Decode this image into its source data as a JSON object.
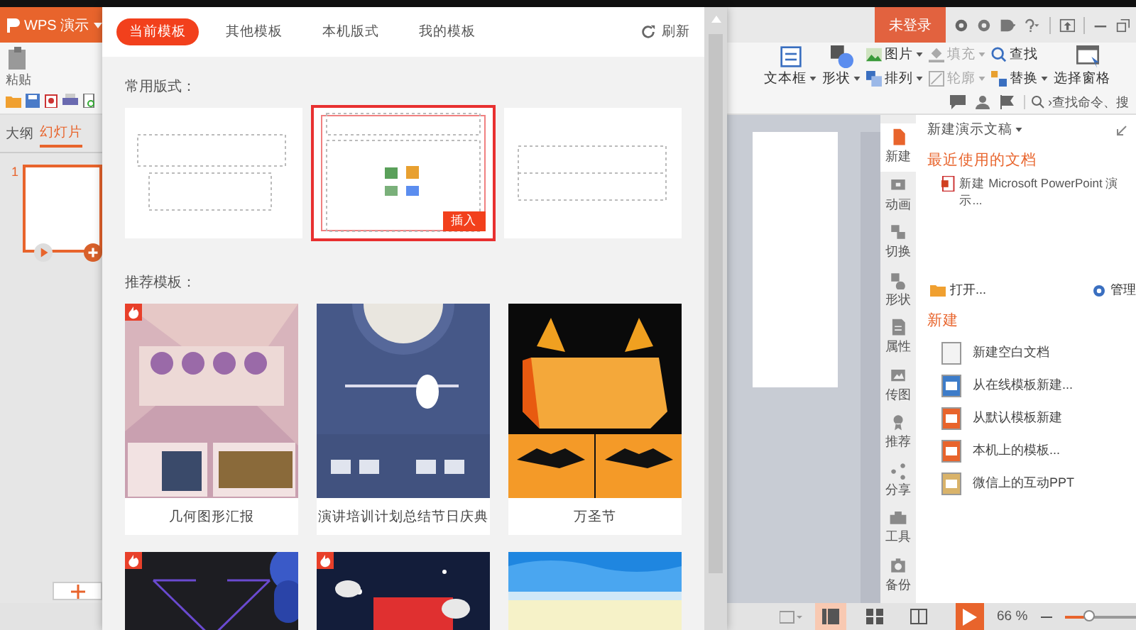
{
  "titlebar": {
    "app_name": "WPS 演示",
    "login": "未登录"
  },
  "ribbon": {
    "paste": "粘贴",
    "columns": [
      [
        {
          "label": "文本框",
          "kind": "textbox",
          "dropdown": true,
          "disabled": false
        }
      ],
      [
        {
          "label": "形状",
          "kind": "shape",
          "dropdown": true,
          "disabled": false
        }
      ],
      [
        {
          "label": "图片",
          "kind": "picture",
          "dropdown": true,
          "disabled": false
        },
        {
          "label": "排列",
          "kind": "arrange",
          "dropdown": true,
          "disabled": false
        }
      ],
      [
        {
          "label": "填充",
          "kind": "fill",
          "dropdown": true,
          "disabled": true
        },
        {
          "label": "轮廓",
          "kind": "outline",
          "dropdown": true,
          "disabled": true
        }
      ],
      [
        {
          "label": "查找",
          "kind": "find",
          "dropdown": false,
          "disabled": false
        },
        {
          "label": "替换",
          "kind": "replace",
          "dropdown": true,
          "disabled": false
        }
      ],
      [
        {
          "label": "选择窗格",
          "kind": "pane",
          "dropdown": false,
          "disabled": false
        }
      ]
    ],
    "search": {
      "placeholder": "›查找命令、搜"
    }
  },
  "slides_panel": {
    "tabs": [
      {
        "label": "大纲",
        "selected": false
      },
      {
        "label": "幻灯片",
        "selected": true
      }
    ],
    "slides": [
      {
        "number": "1",
        "selected": true
      }
    ]
  },
  "gallery": {
    "tabs": [
      {
        "label": "当前模板",
        "selected": true
      },
      {
        "label": "其他模板",
        "selected": false
      },
      {
        "label": "本机版式",
        "selected": false
      },
      {
        "label": "我的模板",
        "selected": false
      }
    ],
    "refresh": "刷新",
    "layouts_heading": "常用版式：",
    "layouts": [
      {
        "kind": "title",
        "selected": false
      },
      {
        "kind": "title_content",
        "selected": true
      },
      {
        "kind": "section",
        "selected": false
      }
    ],
    "insert": "插入",
    "templates_heading": "推荐模板：",
    "templates": [
      {
        "name": "几何图形汇报",
        "kind": "geometry",
        "premium": true
      },
      {
        "name": "演讲培训计划总结节日庆典",
        "kind": "moon",
        "premium": false
      },
      {
        "name": "万圣节",
        "kind": "halloween",
        "premium": false
      },
      {
        "kind": "dark",
        "premium": true
      },
      {
        "kind": "night",
        "premium": true
      },
      {
        "kind": "blue",
        "premium": false
      }
    ]
  },
  "side_tabs": [
    {
      "label": "新建",
      "kind": "new",
      "selected": true
    },
    {
      "label": "动画",
      "kind": "animation",
      "selected": false
    },
    {
      "label": "切换",
      "kind": "transition",
      "selected": false
    },
    {
      "label": "形状",
      "kind": "shape",
      "selected": false
    },
    {
      "label": "属性",
      "kind": "property",
      "selected": false
    },
    {
      "label": "传图",
      "kind": "upload",
      "selected": false
    },
    {
      "label": "推荐",
      "kind": "award",
      "selected": false
    },
    {
      "label": "分享",
      "kind": "share",
      "selected": false
    },
    {
      "label": "工具",
      "kind": "toolbox",
      "selected": false
    },
    {
      "label": "备份",
      "kind": "backup",
      "selected": false
    }
  ],
  "task_pane": {
    "title": "新建演示文稿",
    "recent_heading": "最近使用的文档",
    "recent": [
      {
        "name": "新建 Microsoft PowerPoint 演示..."
      }
    ],
    "open": "打开...",
    "manage": "管理",
    "new_heading": "新建",
    "new_items": [
      {
        "label": "新建空白文档",
        "kind": "blank"
      },
      {
        "label": "从在线模板新建...",
        "kind": "online"
      },
      {
        "label": "从默认模板新建",
        "kind": "default"
      },
      {
        "label": "本机上的模板...",
        "kind": "local"
      },
      {
        "label": "微信上的互动PPT",
        "kind": "wechat"
      }
    ]
  },
  "status_bar": {
    "views": [
      {
        "kind": "normal",
        "selected": true
      },
      {
        "kind": "sorter",
        "selected": false
      },
      {
        "kind": "reading",
        "selected": false
      }
    ],
    "zoom": "66 %",
    "zoom_slider": {
      "level": 0.35
    }
  }
}
